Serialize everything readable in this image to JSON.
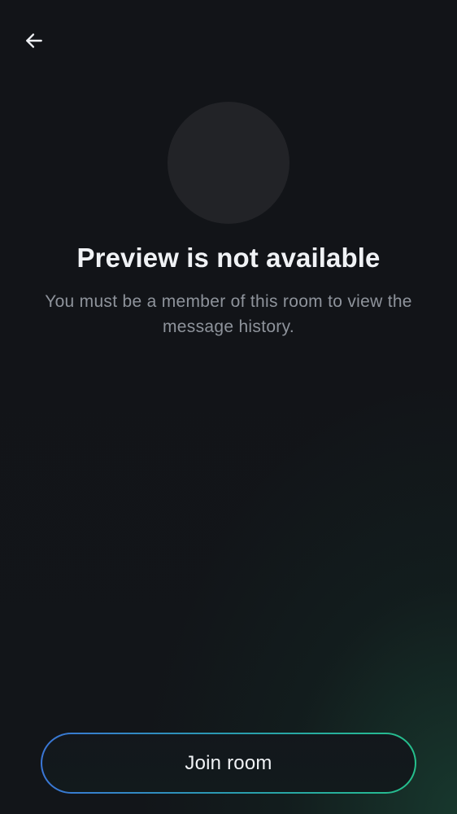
{
  "header": {
    "back_icon": "arrow-left-icon"
  },
  "room": {
    "avatar_color": "#222327"
  },
  "preview": {
    "title": "Preview is not available",
    "message": "You must be a member of this room to view the message history."
  },
  "actions": {
    "join_label": "Join room"
  },
  "colors": {
    "background": "#121418",
    "accent_gradient_start": "#3a76d6",
    "accent_gradient_end": "#25c08c",
    "secondary_text": "#8e939b"
  }
}
